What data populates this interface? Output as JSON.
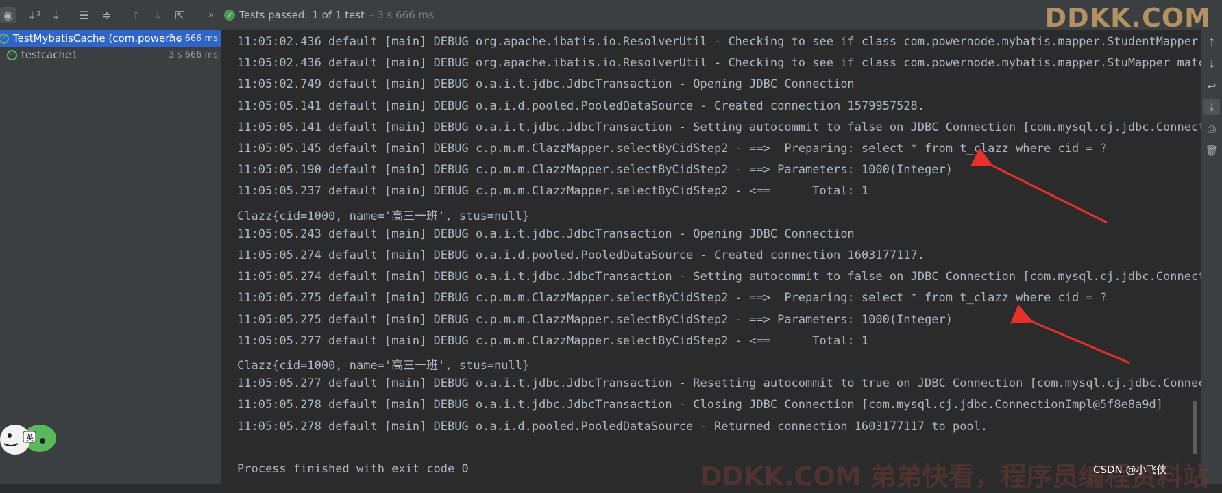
{
  "toolbar": {
    "buttons": [
      "toggle-passed-icon",
      "sort-alpha-icon",
      "sort-duration-icon",
      "expand-all-icon",
      "collapse-all-icon",
      "prev-failed-icon",
      "next-failed-icon",
      "export-icon",
      "more-icon"
    ],
    "status_label": "Tests passed:",
    "status_count": "1 of 1 test",
    "status_time": "– 3 s 666 ms"
  },
  "watermark_top": "DDKK.COM",
  "tree": {
    "root_label": "TestMybatisCache (com.powernc",
    "root_time": "3 s 666 ms",
    "child_label": "testcache1",
    "child_time": "3 s 666 ms"
  },
  "console_lines": [
    "11:05:02.436 default [main] DEBUG org.apache.ibatis.io.ResolverUtil - Checking to see if class com.powernode.mybatis.mapper.StudentMapper mat",
    "11:05:02.436 default [main] DEBUG org.apache.ibatis.io.ResolverUtil - Checking to see if class com.powernode.mybatis.mapper.StuMapper matches",
    "11:05:02.749 default [main] DEBUG o.a.i.t.jdbc.JdbcTransaction - Opening JDBC Connection",
    "11:05:05.141 default [main] DEBUG o.a.i.d.pooled.PooledDataSource - Created connection 1579957528.",
    "11:05:05.141 default [main] DEBUG o.a.i.t.jdbc.JdbcTransaction - Setting autocommit to false on JDBC Connection [com.mysql.cj.jdbc.Connection",
    "11:05:05.145 default [main] DEBUG c.p.m.m.ClazzMapper.selectByCidStep2 - ==>  Preparing: select * from t_clazz where cid = ?",
    "11:05:05.190 default [main] DEBUG c.p.m.m.ClazzMapper.selectByCidStep2 - ==> Parameters: 1000(Integer)",
    "11:05:05.237 default [main] DEBUG c.p.m.m.ClazzMapper.selectByCidStep2 - <==      Total: 1",
    "Clazz{cid=1000, name='高三一班', stus=null}",
    "11:05:05.243 default [main] DEBUG o.a.i.t.jdbc.JdbcTransaction - Opening JDBC Connection",
    "11:05:05.274 default [main] DEBUG o.a.i.d.pooled.PooledDataSource - Created connection 1603177117.",
    "11:05:05.274 default [main] DEBUG o.a.i.t.jdbc.JdbcTransaction - Setting autocommit to false on JDBC Connection [com.mysql.cj.jdbc.Connection",
    "11:05:05.275 default [main] DEBUG c.p.m.m.ClazzMapper.selectByCidStep2 - ==>  Preparing: select * from t_clazz where cid = ?",
    "11:05:05.275 default [main] DEBUG c.p.m.m.ClazzMapper.selectByCidStep2 - ==> Parameters: 1000(Integer)",
    "11:05:05.277 default [main] DEBUG c.p.m.m.ClazzMapper.selectByCidStep2 - <==      Total: 1",
    "Clazz{cid=1000, name='高三一班', stus=null}",
    "11:05:05.277 default [main] DEBUG o.a.i.t.jdbc.JdbcTransaction - Resetting autocommit to true on JDBC Connection [com.mysql.cj.jdbc.Connectio",
    "11:05:05.278 default [main] DEBUG o.a.i.t.jdbc.JdbcTransaction - Closing JDBC Connection [com.mysql.cj.jdbc.ConnectionImpl@5f8e8a9d]",
    "11:05:05.278 default [main] DEBUG o.a.i.d.pooled.PooledDataSource - Returned connection 1603177117 to pool.",
    "",
    "Process finished with exit code 0"
  ],
  "gutter_buttons": [
    "arrow-up-icon",
    "arrow-down-icon",
    "soft-wrap-icon",
    "scroll-to-end-icon",
    "print-icon",
    "trash-icon"
  ],
  "watermark_bottom": "DDKK.COM 弟弟快看，程序员编程资料站",
  "csdn_mark": "CSDN @小飞侠"
}
